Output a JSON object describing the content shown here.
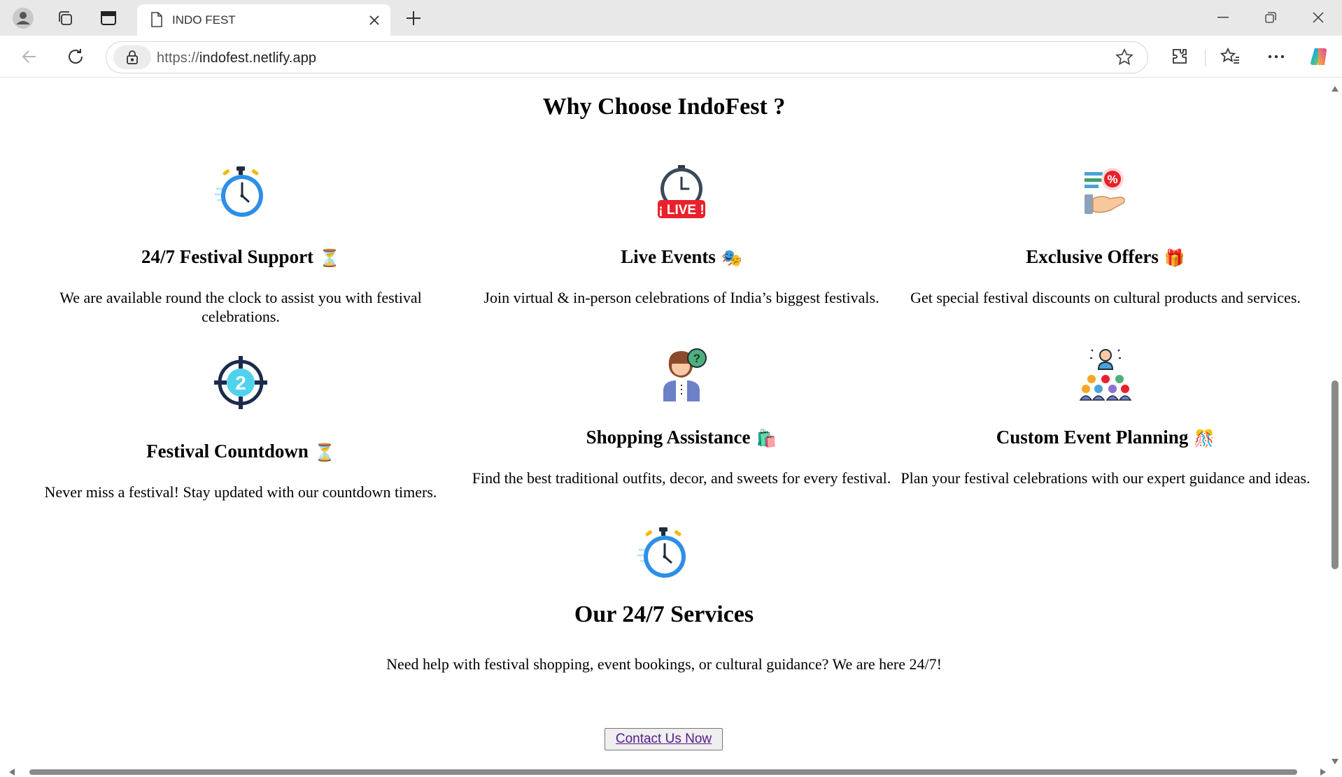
{
  "browser": {
    "tab_title": "INDO FEST",
    "url_protocol": "https://",
    "url_host": "indofest.netlify.app"
  },
  "page": {
    "why_title": "Why Choose IndoFest ?",
    "features": [
      {
        "title": "24/7 Festival Support",
        "emoji": "⏳",
        "icon": "stopwatch-icon",
        "desc": "We are available round the clock to assist you with festival celebrations."
      },
      {
        "title": "Live Events",
        "emoji": "🎭",
        "icon": "live-clock-icon",
        "desc": "Join virtual & in-person celebrations of India’s biggest festivals."
      },
      {
        "title": "Exclusive Offers",
        "emoji": "🎁",
        "icon": "discount-hand-icon",
        "desc": "Get special festival discounts on cultural products and services."
      },
      {
        "title": "Festival Countdown",
        "emoji": "⏳",
        "icon": "countdown-target-icon",
        "desc": "Never miss a festival! Stay updated with our countdown timers."
      },
      {
        "title": "Shopping Assistance",
        "emoji": "🛍️",
        "icon": "support-agent-icon",
        "desc": "Find the best traditional outfits, decor, and sweets for every festival."
      },
      {
        "title": "Custom Event Planning",
        "emoji": "🎊",
        "icon": "audience-presenter-icon",
        "desc": "Plan your festival celebrations with our expert guidance and ideas."
      }
    ],
    "services_title": "Our 24/7 Services",
    "services_text": "Need help with festival shopping, event bookings, or cultural guidance? We are here 24/7!",
    "cta_label": "Contact Us Now"
  }
}
